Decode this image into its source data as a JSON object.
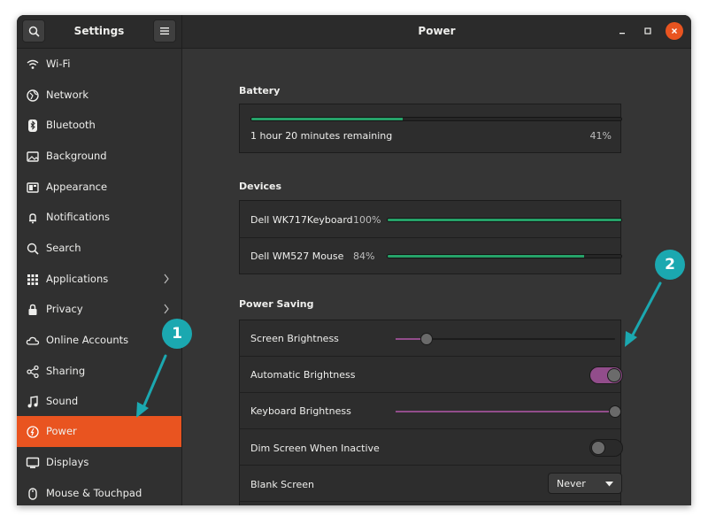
{
  "window": {
    "sidebar_title": "Settings",
    "panel_title": "Power"
  },
  "sidebar": {
    "items": [
      {
        "label": "Wi-Fi",
        "icon": "wifi-icon"
      },
      {
        "label": "Network",
        "icon": "network-icon"
      },
      {
        "label": "Bluetooth",
        "icon": "bluetooth-icon"
      },
      {
        "label": "Background",
        "icon": "background-icon"
      },
      {
        "label": "Appearance",
        "icon": "appearance-icon"
      },
      {
        "label": "Notifications",
        "icon": "bell-icon"
      },
      {
        "label": "Search",
        "icon": "search-icon"
      },
      {
        "label": "Applications",
        "icon": "grid-icon",
        "has_submenu": true
      },
      {
        "label": "Privacy",
        "icon": "lock-icon",
        "has_submenu": true
      },
      {
        "label": "Online Accounts",
        "icon": "cloud-icon"
      },
      {
        "label": "Sharing",
        "icon": "share-icon"
      },
      {
        "label": "Sound",
        "icon": "music-note-icon"
      },
      {
        "label": "Power",
        "icon": "power-icon",
        "active": true
      },
      {
        "label": "Displays",
        "icon": "display-icon"
      },
      {
        "label": "Mouse & Touchpad",
        "icon": "mouse-icon"
      }
    ]
  },
  "battery": {
    "section_title": "Battery",
    "remaining": "1 hour 20 minutes remaining",
    "percent_label": "41%",
    "level": 0.41
  },
  "devices": {
    "section_title": "Devices",
    "items": [
      {
        "name": "Dell WK717Keyboard",
        "percent_label": "100%",
        "level": 1.0
      },
      {
        "name": "Dell WM527 Mouse",
        "percent_label": "84%",
        "level": 0.84
      }
    ]
  },
  "power_saving": {
    "section_title": "Power Saving",
    "screen_brightness": {
      "label": "Screen Brightness",
      "level": 0.14
    },
    "automatic_brightness": {
      "label": "Automatic Brightness",
      "on": true
    },
    "keyboard_brightness": {
      "label": "Keyboard Brightness",
      "level": 1.0
    },
    "dim_screen": {
      "label": "Dim Screen When Inactive",
      "on": false
    },
    "blank_screen": {
      "label": "Blank Screen",
      "value": "Never"
    }
  },
  "annotations": {
    "callout_1": "1",
    "callout_2": "2"
  },
  "colors": {
    "accent": "#e95420",
    "callout": "#1ba8b0",
    "switch_on": "#924d8b",
    "level_fill": "#26a269"
  }
}
